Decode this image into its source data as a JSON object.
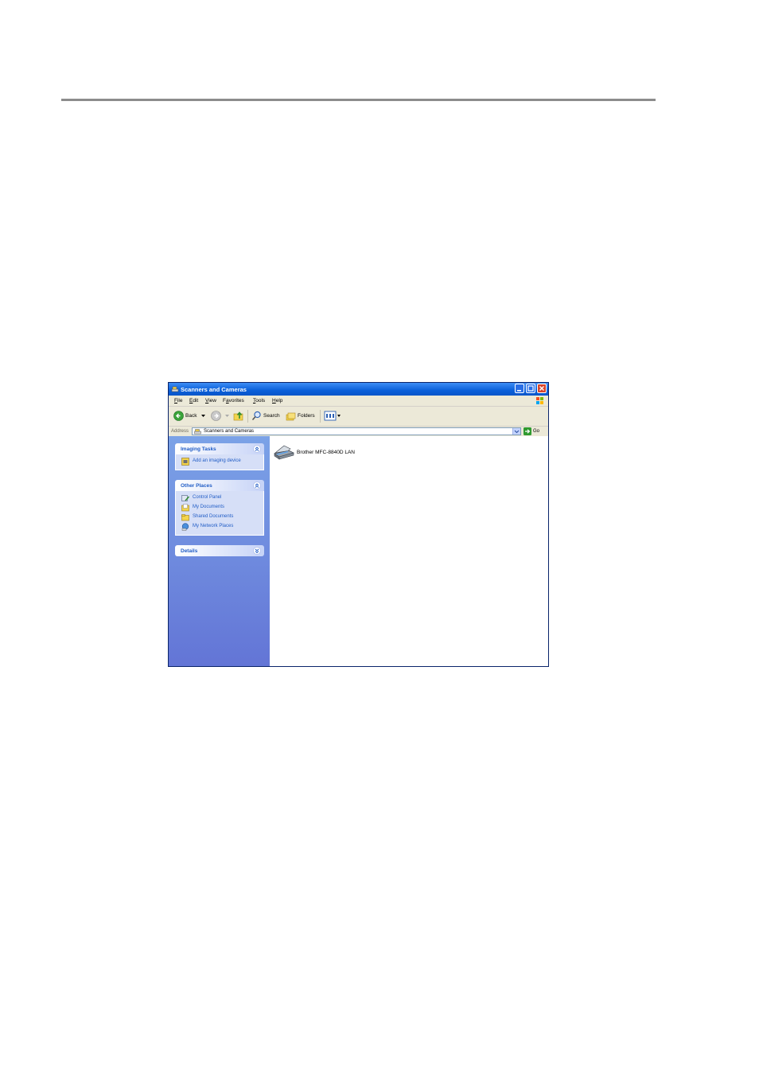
{
  "window": {
    "title": "Scanners and Cameras"
  },
  "menu": {
    "file": "F",
    "file_rest": "ile",
    "edit": "E",
    "edit_rest": "dit",
    "view": "V",
    "view_rest": "iew",
    "favorites_pre": "F",
    "favorites": "a",
    "favorites_rest": "vorites",
    "tools": "T",
    "tools_rest": "ools",
    "help": "H",
    "help_rest": "elp"
  },
  "toolbar": {
    "back": "Back",
    "search": "Search",
    "folders": "Folders"
  },
  "address": {
    "label": "Address",
    "value": "Scanners and Cameras",
    "go": "Go"
  },
  "sidebar": {
    "imaging_tasks": {
      "title": "Imaging Tasks",
      "items": [
        "Add an imaging device"
      ]
    },
    "other_places": {
      "title": "Other Places",
      "items": [
        "Control Panel",
        "My Documents",
        "Shared Documents",
        "My Network Places"
      ]
    },
    "details": {
      "title": "Details"
    }
  },
  "devices": [
    {
      "label": "Brother MFC-8840D LAN",
      "icon": "scanner-icon"
    }
  ],
  "colors": {
    "titlebar": "#0a5fd9",
    "task_link": "#215dc6",
    "task_pane": "#7ba2e7"
  }
}
